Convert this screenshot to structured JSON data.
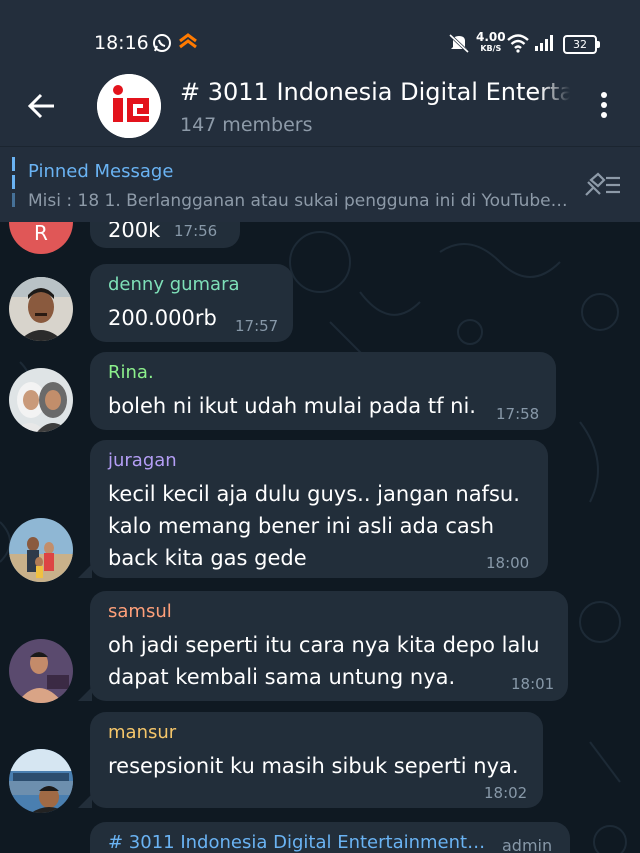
{
  "status_bar": {
    "time": "18:16",
    "net_speed_value": "4.00",
    "net_speed_unit": "KB/S",
    "battery": "32",
    "icons": [
      "whatsapp-icon",
      "app-notification-icon",
      "mute-icon",
      "wifi-icon",
      "signal-icon",
      "battery-icon"
    ]
  },
  "header": {
    "title": "# 3011 Indonesia Digital Entertainment",
    "subtitle": "147 members"
  },
  "pinned": {
    "title": "Pinned Message",
    "text": "Misi : 18 1. Berlangganan atau sukai pengguna ini di YouTube…"
  },
  "messages": [
    {
      "avatar_initial": "R",
      "text": "200k",
      "time": "17:56"
    },
    {
      "name": "denny gumara",
      "name_color": "#7ee0b8",
      "text": "200.000rb",
      "time": "17:57"
    },
    {
      "name": "Rina.",
      "name_color": "#8cf08c",
      "text": "boleh ni ikut udah mulai pada tf ni.",
      "time": "17:58"
    },
    {
      "name": "juragan",
      "name_color": "#b49ef5",
      "lines": [
        "kecil kecil aja dulu guys.. jangan nafsu.",
        "kalo memang bener ini asli ada cash",
        "back kita gas gede"
      ],
      "time": "18:00"
    },
    {
      "name": "samsul",
      "name_color": "#ffa07a",
      "lines": [
        "oh jadi seperti itu cara nya kita depo lalu",
        "dapat kembali sama untung nya."
      ],
      "time": "18:01"
    },
    {
      "name": "mansur",
      "name_color": "#f5c66a",
      "text": "resepsionit ku masih sibuk seperti nya.",
      "time": "18:02"
    },
    {
      "name": "# 3011 Indonesia Digital Entertainment…",
      "name_color": "#6ab3f3",
      "badge": "admin"
    }
  ],
  "colors": {
    "header_bg": "#232e3c",
    "chat_bg": "#0f1922",
    "bubble_bg": "#222e3a",
    "accent": "#6ab3f3"
  }
}
